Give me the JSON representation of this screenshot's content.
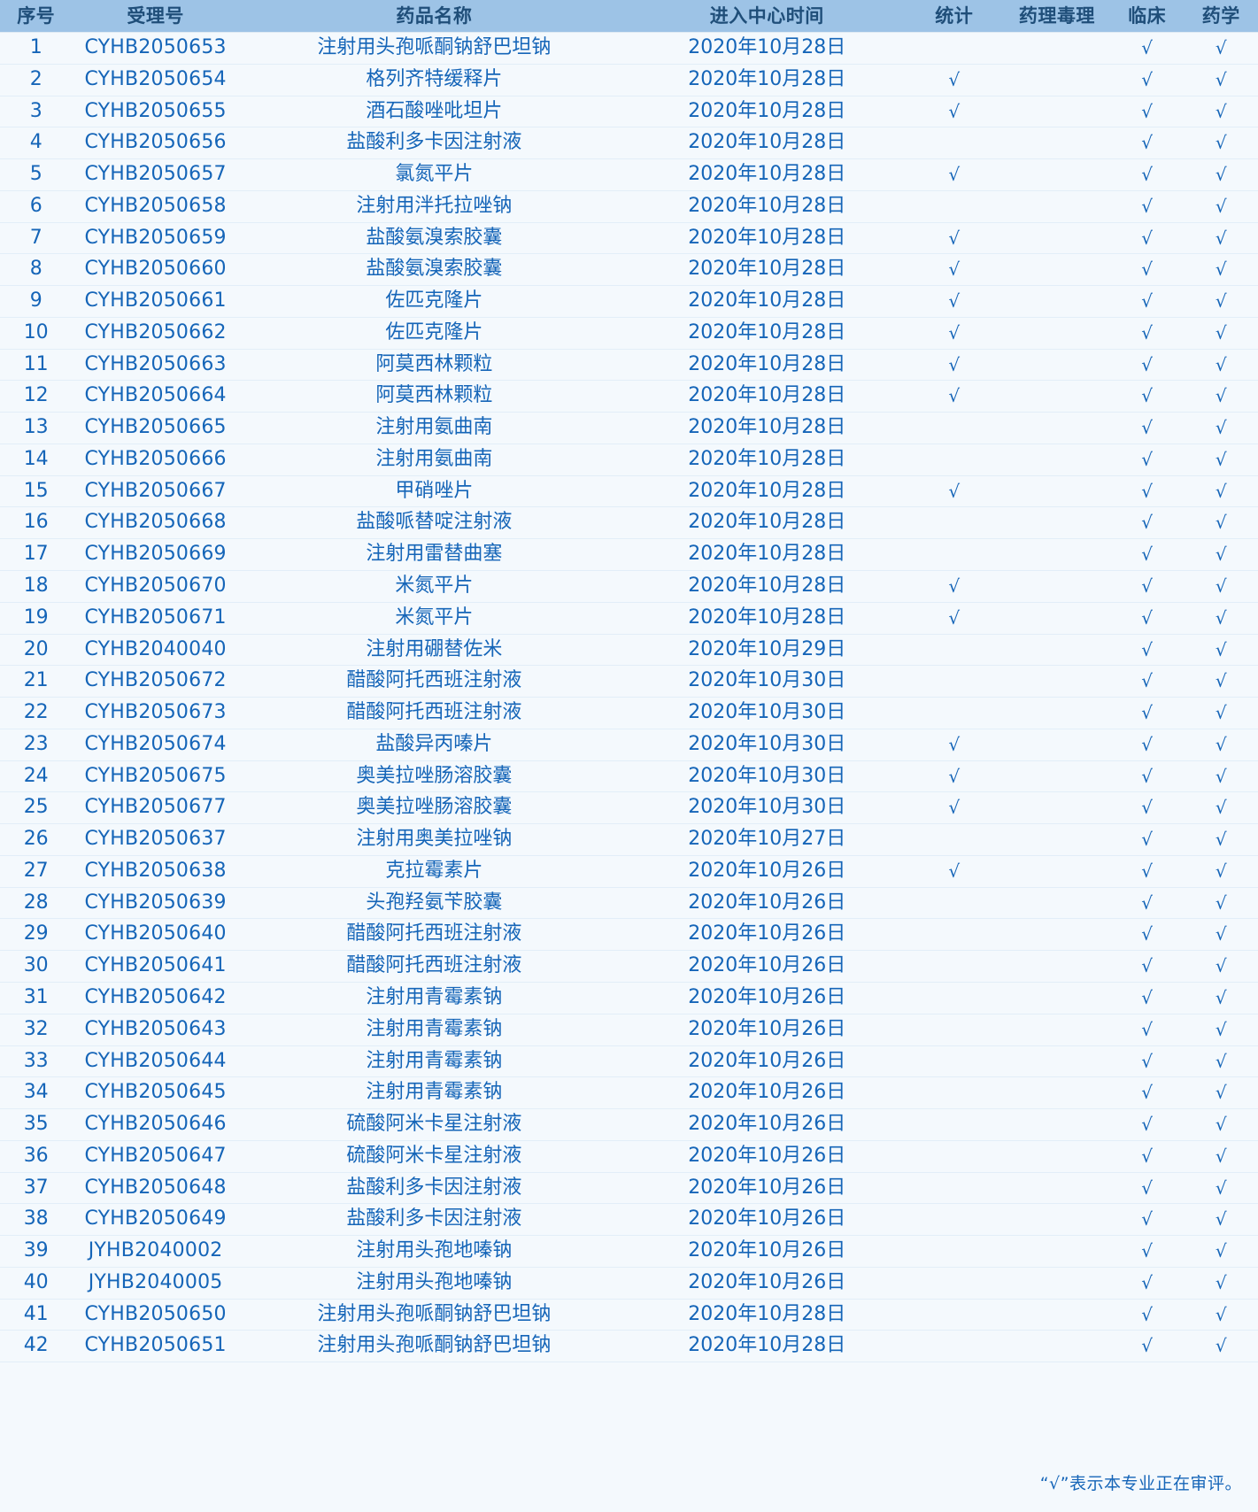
{
  "table": {
    "headers": {
      "seq": "序号",
      "accept_no": "受理号",
      "drug_name": "药品名称",
      "enter_date": "进入中心时间",
      "statistics": "统计",
      "pharm_tox": "药理毒理",
      "clinical": "临床",
      "pharmaceutics": "药学"
    },
    "check_mark": "√",
    "rows": [
      {
        "seq": "1",
        "accept_no": "CYHB2050653",
        "drug_name": "注射用头孢哌酮钠舒巴坦钠",
        "enter_date": "2020年10月28日",
        "statistics": "",
        "pharm_tox": "",
        "clinical": "√",
        "pharmaceutics": "√"
      },
      {
        "seq": "2",
        "accept_no": "CYHB2050654",
        "drug_name": "格列齐特缓释片",
        "enter_date": "2020年10月28日",
        "statistics": "√",
        "pharm_tox": "",
        "clinical": "√",
        "pharmaceutics": "√"
      },
      {
        "seq": "3",
        "accept_no": "CYHB2050655",
        "drug_name": "酒石酸唑吡坦片",
        "enter_date": "2020年10月28日",
        "statistics": "√",
        "pharm_tox": "",
        "clinical": "√",
        "pharmaceutics": "√"
      },
      {
        "seq": "4",
        "accept_no": "CYHB2050656",
        "drug_name": "盐酸利多卡因注射液",
        "enter_date": "2020年10月28日",
        "statistics": "",
        "pharm_tox": "",
        "clinical": "√",
        "pharmaceutics": "√"
      },
      {
        "seq": "5",
        "accept_no": "CYHB2050657",
        "drug_name": "氯氮平片",
        "enter_date": "2020年10月28日",
        "statistics": "√",
        "pharm_tox": "",
        "clinical": "√",
        "pharmaceutics": "√"
      },
      {
        "seq": "6",
        "accept_no": "CYHB2050658",
        "drug_name": "注射用泮托拉唑钠",
        "enter_date": "2020年10月28日",
        "statistics": "",
        "pharm_tox": "",
        "clinical": "√",
        "pharmaceutics": "√"
      },
      {
        "seq": "7",
        "accept_no": "CYHB2050659",
        "drug_name": "盐酸氨溴索胶囊",
        "enter_date": "2020年10月28日",
        "statistics": "√",
        "pharm_tox": "",
        "clinical": "√",
        "pharmaceutics": "√"
      },
      {
        "seq": "8",
        "accept_no": "CYHB2050660",
        "drug_name": "盐酸氨溴索胶囊",
        "enter_date": "2020年10月28日",
        "statistics": "√",
        "pharm_tox": "",
        "clinical": "√",
        "pharmaceutics": "√"
      },
      {
        "seq": "9",
        "accept_no": "CYHB2050661",
        "drug_name": "佐匹克隆片",
        "enter_date": "2020年10月28日",
        "statistics": "√",
        "pharm_tox": "",
        "clinical": "√",
        "pharmaceutics": "√"
      },
      {
        "seq": "10",
        "accept_no": "CYHB2050662",
        "drug_name": "佐匹克隆片",
        "enter_date": "2020年10月28日",
        "statistics": "√",
        "pharm_tox": "",
        "clinical": "√",
        "pharmaceutics": "√"
      },
      {
        "seq": "11",
        "accept_no": "CYHB2050663",
        "drug_name": "阿莫西林颗粒",
        "enter_date": "2020年10月28日",
        "statistics": "√",
        "pharm_tox": "",
        "clinical": "√",
        "pharmaceutics": "√"
      },
      {
        "seq": "12",
        "accept_no": "CYHB2050664",
        "drug_name": "阿莫西林颗粒",
        "enter_date": "2020年10月28日",
        "statistics": "√",
        "pharm_tox": "",
        "clinical": "√",
        "pharmaceutics": "√"
      },
      {
        "seq": "13",
        "accept_no": "CYHB2050665",
        "drug_name": "注射用氨曲南",
        "enter_date": "2020年10月28日",
        "statistics": "",
        "pharm_tox": "",
        "clinical": "√",
        "pharmaceutics": "√"
      },
      {
        "seq": "14",
        "accept_no": "CYHB2050666",
        "drug_name": "注射用氨曲南",
        "enter_date": "2020年10月28日",
        "statistics": "",
        "pharm_tox": "",
        "clinical": "√",
        "pharmaceutics": "√"
      },
      {
        "seq": "15",
        "accept_no": "CYHB2050667",
        "drug_name": "甲硝唑片",
        "enter_date": "2020年10月28日",
        "statistics": "√",
        "pharm_tox": "",
        "clinical": "√",
        "pharmaceutics": "√"
      },
      {
        "seq": "16",
        "accept_no": "CYHB2050668",
        "drug_name": "盐酸哌替啶注射液",
        "enter_date": "2020年10月28日",
        "statistics": "",
        "pharm_tox": "",
        "clinical": "√",
        "pharmaceutics": "√"
      },
      {
        "seq": "17",
        "accept_no": "CYHB2050669",
        "drug_name": "注射用雷替曲塞",
        "enter_date": "2020年10月28日",
        "statistics": "",
        "pharm_tox": "",
        "clinical": "√",
        "pharmaceutics": "√"
      },
      {
        "seq": "18",
        "accept_no": "CYHB2050670",
        "drug_name": "米氮平片",
        "enter_date": "2020年10月28日",
        "statistics": "√",
        "pharm_tox": "",
        "clinical": "√",
        "pharmaceutics": "√"
      },
      {
        "seq": "19",
        "accept_no": "CYHB2050671",
        "drug_name": "米氮平片",
        "enter_date": "2020年10月28日",
        "statistics": "√",
        "pharm_tox": "",
        "clinical": "√",
        "pharmaceutics": "√"
      },
      {
        "seq": "20",
        "accept_no": "CYHB2040040",
        "drug_name": "注射用硼替佐米",
        "enter_date": "2020年10月29日",
        "statistics": "",
        "pharm_tox": "",
        "clinical": "√",
        "pharmaceutics": "√"
      },
      {
        "seq": "21",
        "accept_no": "CYHB2050672",
        "drug_name": "醋酸阿托西班注射液",
        "enter_date": "2020年10月30日",
        "statistics": "",
        "pharm_tox": "",
        "clinical": "√",
        "pharmaceutics": "√"
      },
      {
        "seq": "22",
        "accept_no": "CYHB2050673",
        "drug_name": "醋酸阿托西班注射液",
        "enter_date": "2020年10月30日",
        "statistics": "",
        "pharm_tox": "",
        "clinical": "√",
        "pharmaceutics": "√"
      },
      {
        "seq": "23",
        "accept_no": "CYHB2050674",
        "drug_name": "盐酸异丙嗪片",
        "enter_date": "2020年10月30日",
        "statistics": "√",
        "pharm_tox": "",
        "clinical": "√",
        "pharmaceutics": "√"
      },
      {
        "seq": "24",
        "accept_no": "CYHB2050675",
        "drug_name": "奥美拉唑肠溶胶囊",
        "enter_date": "2020年10月30日",
        "statistics": "√",
        "pharm_tox": "",
        "clinical": "√",
        "pharmaceutics": "√"
      },
      {
        "seq": "25",
        "accept_no": "CYHB2050677",
        "drug_name": "奥美拉唑肠溶胶囊",
        "enter_date": "2020年10月30日",
        "statistics": "√",
        "pharm_tox": "",
        "clinical": "√",
        "pharmaceutics": "√"
      },
      {
        "seq": "26",
        "accept_no": "CYHB2050637",
        "drug_name": "注射用奥美拉唑钠",
        "enter_date": "2020年10月27日",
        "statistics": "",
        "pharm_tox": "",
        "clinical": "√",
        "pharmaceutics": "√"
      },
      {
        "seq": "27",
        "accept_no": "CYHB2050638",
        "drug_name": "克拉霉素片",
        "enter_date": "2020年10月26日",
        "statistics": "√",
        "pharm_tox": "",
        "clinical": "√",
        "pharmaceutics": "√"
      },
      {
        "seq": "28",
        "accept_no": "CYHB2050639",
        "drug_name": "头孢羟氨苄胶囊",
        "enter_date": "2020年10月26日",
        "statistics": "",
        "pharm_tox": "",
        "clinical": "√",
        "pharmaceutics": "√"
      },
      {
        "seq": "29",
        "accept_no": "CYHB2050640",
        "drug_name": "醋酸阿托西班注射液",
        "enter_date": "2020年10月26日",
        "statistics": "",
        "pharm_tox": "",
        "clinical": "√",
        "pharmaceutics": "√"
      },
      {
        "seq": "30",
        "accept_no": "CYHB2050641",
        "drug_name": "醋酸阿托西班注射液",
        "enter_date": "2020年10月26日",
        "statistics": "",
        "pharm_tox": "",
        "clinical": "√",
        "pharmaceutics": "√"
      },
      {
        "seq": "31",
        "accept_no": "CYHB2050642",
        "drug_name": "注射用青霉素钠",
        "enter_date": "2020年10月26日",
        "statistics": "",
        "pharm_tox": "",
        "clinical": "√",
        "pharmaceutics": "√"
      },
      {
        "seq": "32",
        "accept_no": "CYHB2050643",
        "drug_name": "注射用青霉素钠",
        "enter_date": "2020年10月26日",
        "statistics": "",
        "pharm_tox": "",
        "clinical": "√",
        "pharmaceutics": "√"
      },
      {
        "seq": "33",
        "accept_no": "CYHB2050644",
        "drug_name": "注射用青霉素钠",
        "enter_date": "2020年10月26日",
        "statistics": "",
        "pharm_tox": "",
        "clinical": "√",
        "pharmaceutics": "√"
      },
      {
        "seq": "34",
        "accept_no": "CYHB2050645",
        "drug_name": "注射用青霉素钠",
        "enter_date": "2020年10月26日",
        "statistics": "",
        "pharm_tox": "",
        "clinical": "√",
        "pharmaceutics": "√"
      },
      {
        "seq": "35",
        "accept_no": "CYHB2050646",
        "drug_name": "硫酸阿米卡星注射液",
        "enter_date": "2020年10月26日",
        "statistics": "",
        "pharm_tox": "",
        "clinical": "√",
        "pharmaceutics": "√"
      },
      {
        "seq": "36",
        "accept_no": "CYHB2050647",
        "drug_name": "硫酸阿米卡星注射液",
        "enter_date": "2020年10月26日",
        "statistics": "",
        "pharm_tox": "",
        "clinical": "√",
        "pharmaceutics": "√"
      },
      {
        "seq": "37",
        "accept_no": "CYHB2050648",
        "drug_name": "盐酸利多卡因注射液",
        "enter_date": "2020年10月26日",
        "statistics": "",
        "pharm_tox": "",
        "clinical": "√",
        "pharmaceutics": "√"
      },
      {
        "seq": "38",
        "accept_no": "CYHB2050649",
        "drug_name": "盐酸利多卡因注射液",
        "enter_date": "2020年10月26日",
        "statistics": "",
        "pharm_tox": "",
        "clinical": "√",
        "pharmaceutics": "√"
      },
      {
        "seq": "39",
        "accept_no": "JYHB2040002",
        "drug_name": "注射用头孢地嗪钠",
        "enter_date": "2020年10月26日",
        "statistics": "",
        "pharm_tox": "",
        "clinical": "√",
        "pharmaceutics": "√"
      },
      {
        "seq": "40",
        "accept_no": "JYHB2040005",
        "drug_name": "注射用头孢地嗪钠",
        "enter_date": "2020年10月26日",
        "statistics": "",
        "pharm_tox": "",
        "clinical": "√",
        "pharmaceutics": "√"
      },
      {
        "seq": "41",
        "accept_no": "CYHB2050650",
        "drug_name": "注射用头孢哌酮钠舒巴坦钠",
        "enter_date": "2020年10月28日",
        "statistics": "",
        "pharm_tox": "",
        "clinical": "√",
        "pharmaceutics": "√"
      },
      {
        "seq": "42",
        "accept_no": "CYHB2050651",
        "drug_name": "注射用头孢哌酮钠舒巴坦钠",
        "enter_date": "2020年10月28日",
        "statistics": "",
        "pharm_tox": "",
        "clinical": "√",
        "pharmaceutics": "√"
      }
    ]
  },
  "footnote": "“√”表示本专业正在审评。",
  "colors": {
    "header_background": "#9dc3e6",
    "header_text": "#1f4e79",
    "body_background": "#f4f9fd",
    "body_text": "#1565b8",
    "row_divider": "#e2eef8"
  }
}
